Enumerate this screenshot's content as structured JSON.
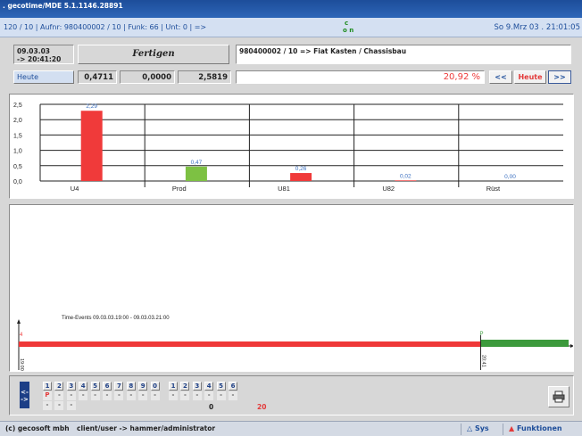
{
  "window": {
    "title": ". gecotime/MDE  5.1.1146.28891"
  },
  "infobar": {
    "left": "120 / 10 |  Aufnr: 980400002 / 10 |  Funk: 66 |  Unt: 0 |  =>",
    "center_top": "c",
    "center_bottom": "o n",
    "right": "So 9.Mrz 03 . 21:01:05"
  },
  "header": {
    "date": "09.03.03",
    "time_to": "-> 20:41:20",
    "status": "Fertigen",
    "order": "980400002 / 10  =>  Fiat Kasten / Chassisbau",
    "period_label": "Heute",
    "value1": "0,4711",
    "value2": "0,0000",
    "value3": "2,5819",
    "percent": "20,92 %",
    "prev_button": "<<",
    "period_button": "Heute",
    "next_button": ">>"
  },
  "chart_data": {
    "type": "bar",
    "categories": [
      "U4",
      "Prod",
      "U81",
      "U82",
      "Rüst"
    ],
    "values": [
      2.29,
      0.47,
      0.26,
      0.02,
      0.0
    ],
    "data_labels": [
      "2,29",
      "0,47",
      "0,26",
      "0,02",
      "0,00"
    ],
    "bar_colors": [
      "#f03a3a",
      "#7dc143",
      "#f03a3a",
      "#f03a3a",
      "#f03a3a"
    ],
    "yticks": [
      "0,0",
      "0,5",
      "1,0",
      "1,5",
      "2,0",
      "2,5"
    ],
    "ylim": [
      0,
      2.5
    ],
    "grid": true
  },
  "timeline": {
    "caption": "Time-Events  09.03.03.19:00 - 09.03.03.21:00",
    "start_label": "19:00",
    "marker_label": "20:41",
    "red_marker": "4",
    "green_marker": "P",
    "red_color": "#ef3838",
    "green_color": "#3c9a3c",
    "split_fraction": 0.84
  },
  "days": {
    "prev": "<-",
    "next": "->",
    "group1": [
      "1",
      "2",
      "3",
      "4",
      "5",
      "6",
      "7",
      "8",
      "9",
      "0"
    ],
    "group2": [
      "1",
      "2",
      "3",
      "4",
      "5",
      "6"
    ],
    "row2_first": "P",
    "dash": "-",
    "count1": "0",
    "count2": "20"
  },
  "footer": {
    "company": "(c) gecosoft mbh",
    "user": "client/user  -> hammer/administrator",
    "sys_button": "Sys",
    "functions_button": "Funktionen"
  }
}
